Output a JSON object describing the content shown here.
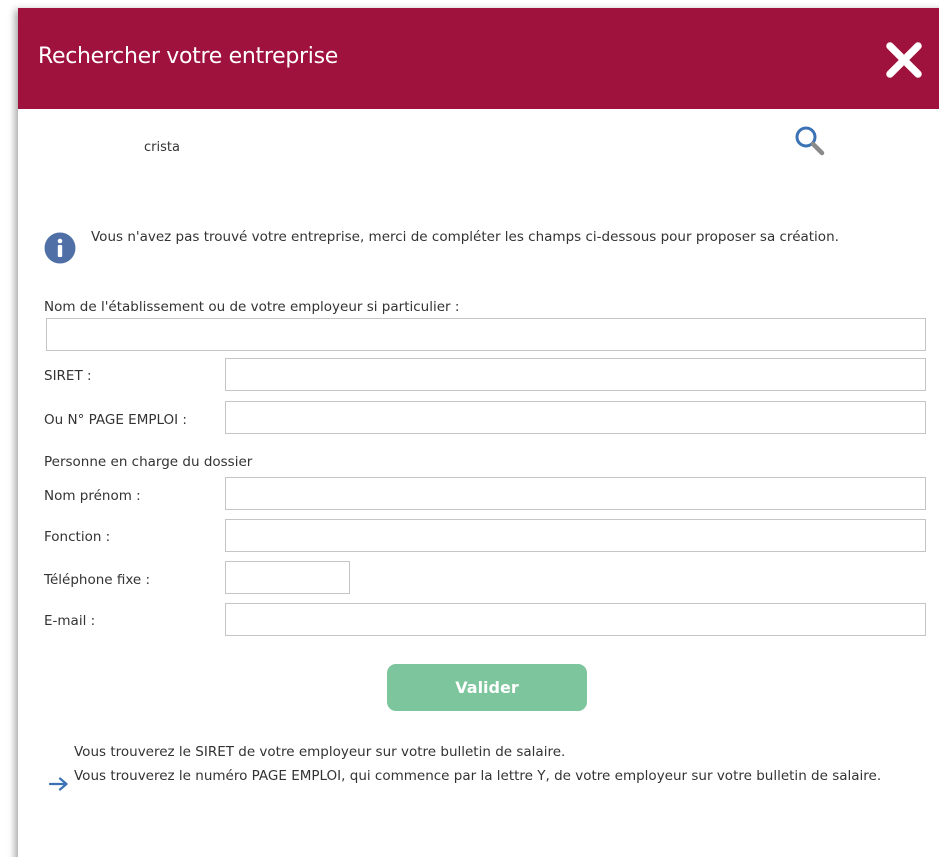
{
  "modal": {
    "title": "Rechercher votre entreprise",
    "accent_color": "#a0123e"
  },
  "search": {
    "value": "crista",
    "icon": "magnifier-icon"
  },
  "info": {
    "icon": "info-icon",
    "text": "Vous n'avez pas trouvé votre entreprise, merci de compléter les champs ci-dessous pour proposer sa création."
  },
  "form": {
    "establishment_label": "Nom de l'établissement ou de votre employeur si particulier :",
    "establishment_value": "",
    "siret_label": "SIRET :",
    "siret_value": "",
    "page_emploi_label": "Ou N° PAGE EMPLOI :",
    "page_emploi_value": "",
    "contact_section_label": "Personne en charge du dossier",
    "name_label": "Nom prénom :",
    "name_value": "",
    "function_label": "Fonction :",
    "function_value": "",
    "phone_label": "Téléphone fixe :",
    "phone_value": "",
    "email_label": "E-mail :",
    "email_value": "",
    "submit_label": "Valider",
    "submit_color": "#7dc59d"
  },
  "hints": {
    "icon": "arrow-right-icon",
    "siret_hint": "Vous trouverez le SIRET de votre employeur sur votre bulletin de salaire.",
    "page_emploi_hint": "Vous trouverez le numéro PAGE EMPLOI, qui commence par la lettre Y, de votre employeur sur votre bulletin de salaire."
  }
}
